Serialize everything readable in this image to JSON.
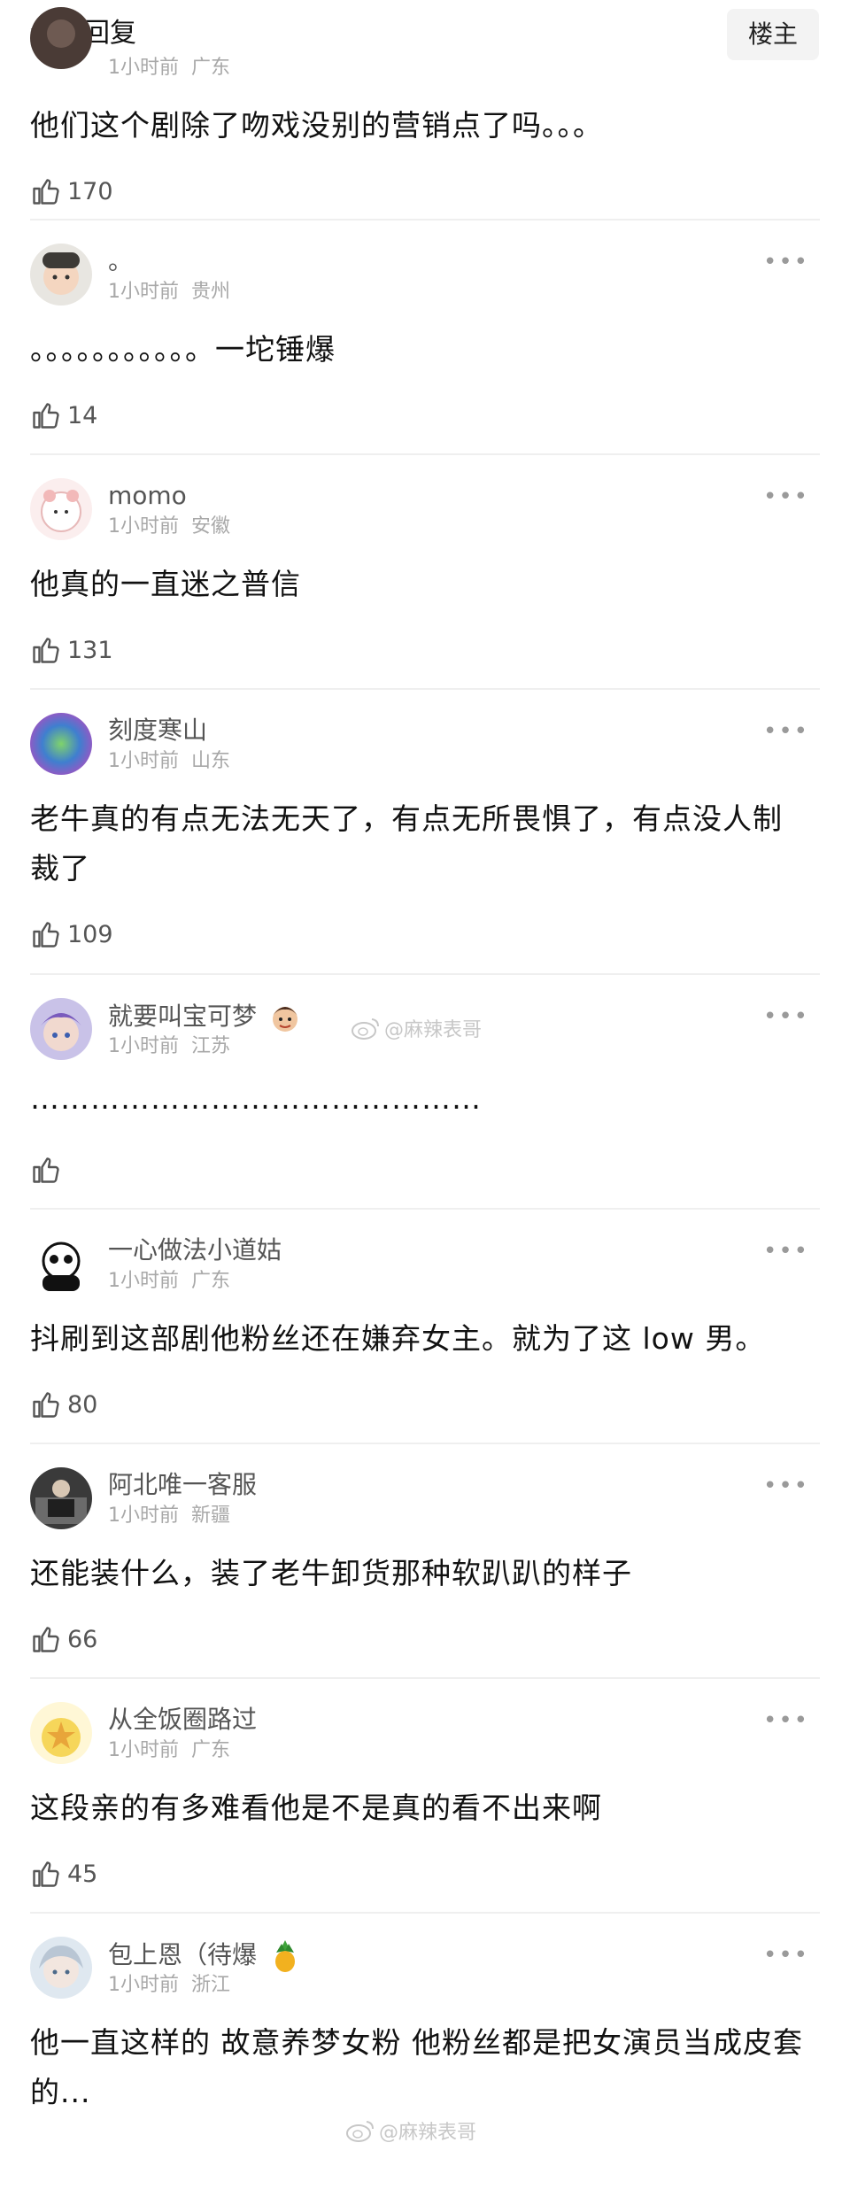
{
  "header": {
    "title": "全部回复",
    "owner_label": "楼主"
  },
  "watermark": "@麻辣表哥",
  "comments": [
    {
      "username": "",
      "time": "1小时前",
      "location": "广东",
      "text": "他们这个剧除了吻戏没别的营销点了吗。。。",
      "likes": "170"
    },
    {
      "username": "。",
      "time": "1小时前",
      "location": "贵州",
      "text": "。。。。。。。。。。。一坨锤爆",
      "likes": "14"
    },
    {
      "username": "momo",
      "time": "1小时前",
      "location": "安徽",
      "text": "他真的一直迷之普信",
      "likes": "131"
    },
    {
      "username": "刻度寒山",
      "time": "1小时前",
      "location": "山东",
      "text": "老牛真的有点无法无天了，有点无所畏惧了，有点没人制裁了",
      "likes": "109"
    },
    {
      "username": "就要叫宝可梦",
      "time": "1小时前",
      "location": "江苏",
      "text": "………………………………………",
      "likes": ""
    },
    {
      "username": "一心做法小道姑",
      "time": "1小时前",
      "location": "广东",
      "text": "抖刷到这部剧他粉丝还在嫌弃女主。就为了这 low 男。",
      "likes": "80"
    },
    {
      "username": "阿北唯一客服",
      "time": "1小时前",
      "location": "新疆",
      "text": "还能装什么，装了老牛卸货那种软趴趴的样子",
      "likes": "66"
    },
    {
      "username": "从全饭圈路过",
      "time": "1小时前",
      "location": "广东",
      "text": "这段亲的有多难看他是不是真的看不出来啊",
      "likes": "45"
    },
    {
      "username": "包上恩（待爆",
      "time": "1小时前",
      "location": "浙江",
      "text": "他一直这样的  故意养梦女粉    他粉丝都是把女演员当成皮套的...",
      "likes": ""
    }
  ],
  "colors": {
    "divider": "#efefef",
    "meta": "#a8a8a8",
    "text": "#111111"
  },
  "icons": {
    "like": "thumbs-up-icon",
    "more": "more-dots-icon"
  }
}
